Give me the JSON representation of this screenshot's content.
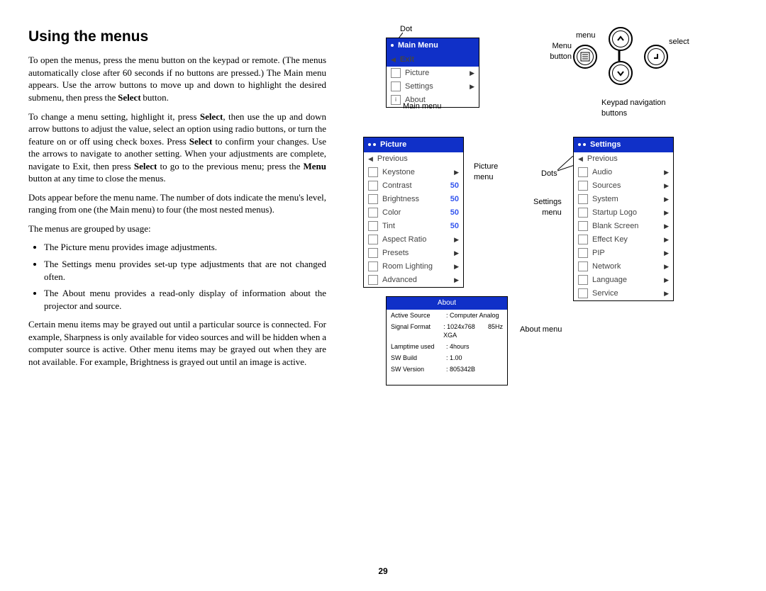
{
  "heading": "Using the menus",
  "para1_a": "To open the menus, press the menu button on the keypad or remote. (The menus automatically close after 60 seconds if no buttons are pressed.) The Main menu appears. Use the arrow buttons to move up and down to highlight the desired submenu, then press the ",
  "para1_b": " button.",
  "para2_a": "To change a menu setting, highlight it, press ",
  "para2_b": ", then use the up and down arrow buttons to adjust the value, select an option using radio buttons, or turn the feature on or off using check boxes. Press ",
  "para2_c": " to confirm your changes. Use the arrows to navigate to another setting. When your adjustments are complete, navigate to Exit, then press ",
  "para2_d": " to go to the previous menu; press the ",
  "para2_e": " button at any time to close the menus.",
  "para3": "Dots appear before the menu name. The number of dots indicate the menu's level, ranging from one (the Main menu) to four (the most nested menus).",
  "para4": "The menus are grouped by usage:",
  "bullets": [
    "The Picture menu provides image adjustments.",
    "The Settings menu provides set-up type adjustments that are not changed often.",
    "The About menu provides a read-only display of information about the projector and source."
  ],
  "para5": "Certain menu items may be grayed out until a particular source is connected. For example, Sharpness is only available for video sources and will be hidden when a computer source is active. Other menu items may be grayed out when they are not available. For example, Brightness is grayed out until an image is active.",
  "bold_select": "Select",
  "bold_menu": "Menu",
  "pagenum": "29",
  "labels": {
    "dot": "Dot",
    "mainmenu": "Main menu",
    "menubutton1": "Menu",
    "menubutton2": "button",
    "menu": "menu",
    "select": "select",
    "keypad1": "Keypad navigation",
    "keypad2": "buttons",
    "picturemenu1": "Picture",
    "picturemenu2": "menu",
    "dots": "Dots",
    "settingsmenu1": "Settings",
    "settingsmenu2": "menu",
    "aboutmenu": "About menu"
  },
  "mainmenu": {
    "title": "Main Menu",
    "exit": "Exit",
    "items": [
      "Picture",
      "Settings",
      "About"
    ]
  },
  "picture": {
    "title": "Picture",
    "prev": "Previous",
    "rows": [
      {
        "l": "Keystone",
        "a": true
      },
      {
        "l": "Contrast",
        "v": "50"
      },
      {
        "l": "Brightness",
        "v": "50"
      },
      {
        "l": "Color",
        "v": "50"
      },
      {
        "l": "Tint",
        "v": "50"
      },
      {
        "l": "Aspect Ratio",
        "a": true
      },
      {
        "l": "Presets",
        "a": true
      },
      {
        "l": "Room Lighting",
        "a": true
      },
      {
        "l": "Advanced",
        "a": true
      }
    ]
  },
  "settings": {
    "title": "Settings",
    "prev": "Previous",
    "rows": [
      "Audio",
      "Sources",
      "System",
      "Startup Logo",
      "Blank Screen",
      "Effect Key",
      "PIP",
      "Network",
      "Language",
      "Service"
    ]
  },
  "about": {
    "title": "About",
    "rows": [
      [
        "Active Source",
        ": Computer Analog",
        ""
      ],
      [
        "Signal Format",
        ": 1024x768  XGA",
        "85Hz"
      ],
      [
        "Lamptime used",
        ": 4hours",
        ""
      ],
      [
        "SW Build",
        ": 1.00",
        ""
      ],
      [
        "SW Version",
        ": 805342B",
        ""
      ]
    ]
  }
}
